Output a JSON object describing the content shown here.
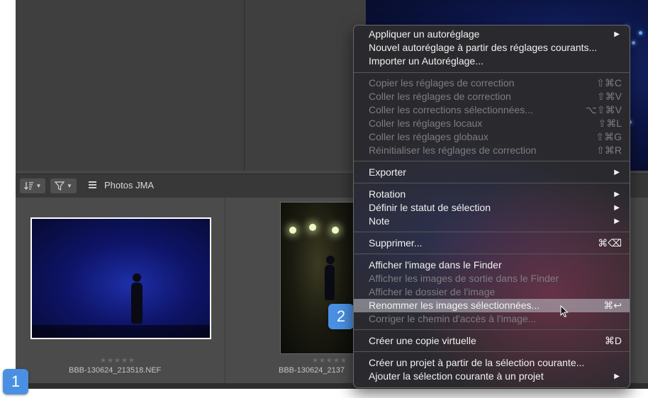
{
  "toolbar": {
    "sort_icon": "sort-icon",
    "filter_icon": "filter-icon",
    "grid_icon": "grid-icon",
    "album_label": "Photos JMA"
  },
  "thumbnails": [
    {
      "stars": "★★★★★",
      "filename": "BBB-130624_213518.NEF"
    },
    {
      "stars": "★★★★★",
      "filename": "BBB-130624_2137"
    }
  ],
  "badges": {
    "one": "1",
    "two": "2"
  },
  "context_menu": {
    "g1": [
      {
        "label": "Appliquer un autoréglage",
        "shortcut": "▶"
      },
      {
        "label": "Nouvel autoréglage à partir des réglages courants...",
        "shortcut": ""
      },
      {
        "label": "Importer un Autoréglage...",
        "shortcut": ""
      }
    ],
    "g2": [
      {
        "label": "Copier les réglages de correction",
        "shortcut": "⇧⌘C"
      },
      {
        "label": "Coller les réglages de correction",
        "shortcut": "⇧⌘V"
      },
      {
        "label": "Coller les corrections sélectionnées...",
        "shortcut": "⌥⇧⌘V"
      },
      {
        "label": "Coller les réglages locaux",
        "shortcut": "⇧⌘L"
      },
      {
        "label": "Coller les réglages globaux",
        "shortcut": "⇧⌘G"
      },
      {
        "label": "Réinitialiser les réglages de correction",
        "shortcut": "⇧⌘R"
      }
    ],
    "g3": [
      {
        "label": "Exporter",
        "shortcut": "▶"
      }
    ],
    "g4": [
      {
        "label": "Rotation",
        "shortcut": "▶"
      },
      {
        "label": "Définir le statut de sélection",
        "shortcut": "▶"
      },
      {
        "label": "Note",
        "shortcut": "▶"
      }
    ],
    "g5": [
      {
        "label": "Supprimer...",
        "shortcut": "⌘⌫"
      }
    ],
    "g6": [
      {
        "label": "Afficher l'image dans le Finder",
        "shortcut": ""
      },
      {
        "label": "Afficher les images de sortie dans le Finder",
        "shortcut": ""
      },
      {
        "label": "Afficher le dossier de l'image",
        "shortcut": ""
      },
      {
        "label": "Renommer les images sélectionnées...",
        "shortcut": "⌘↩"
      },
      {
        "label": "Corriger le chemin d'accès à l'image...",
        "shortcut": ""
      }
    ],
    "g7": [
      {
        "label": "Créer une copie virtuelle",
        "shortcut": "⌘D"
      }
    ],
    "g8": [
      {
        "label": "Créer un projet à partir de la sélection courante...",
        "shortcut": ""
      },
      {
        "label": "Ajouter la sélection courante à un projet",
        "shortcut": "▶"
      }
    ]
  },
  "colors": {
    "highlight": "#bcbcc4",
    "badge": "#4a90e2",
    "selection_border": "#ffffff"
  }
}
